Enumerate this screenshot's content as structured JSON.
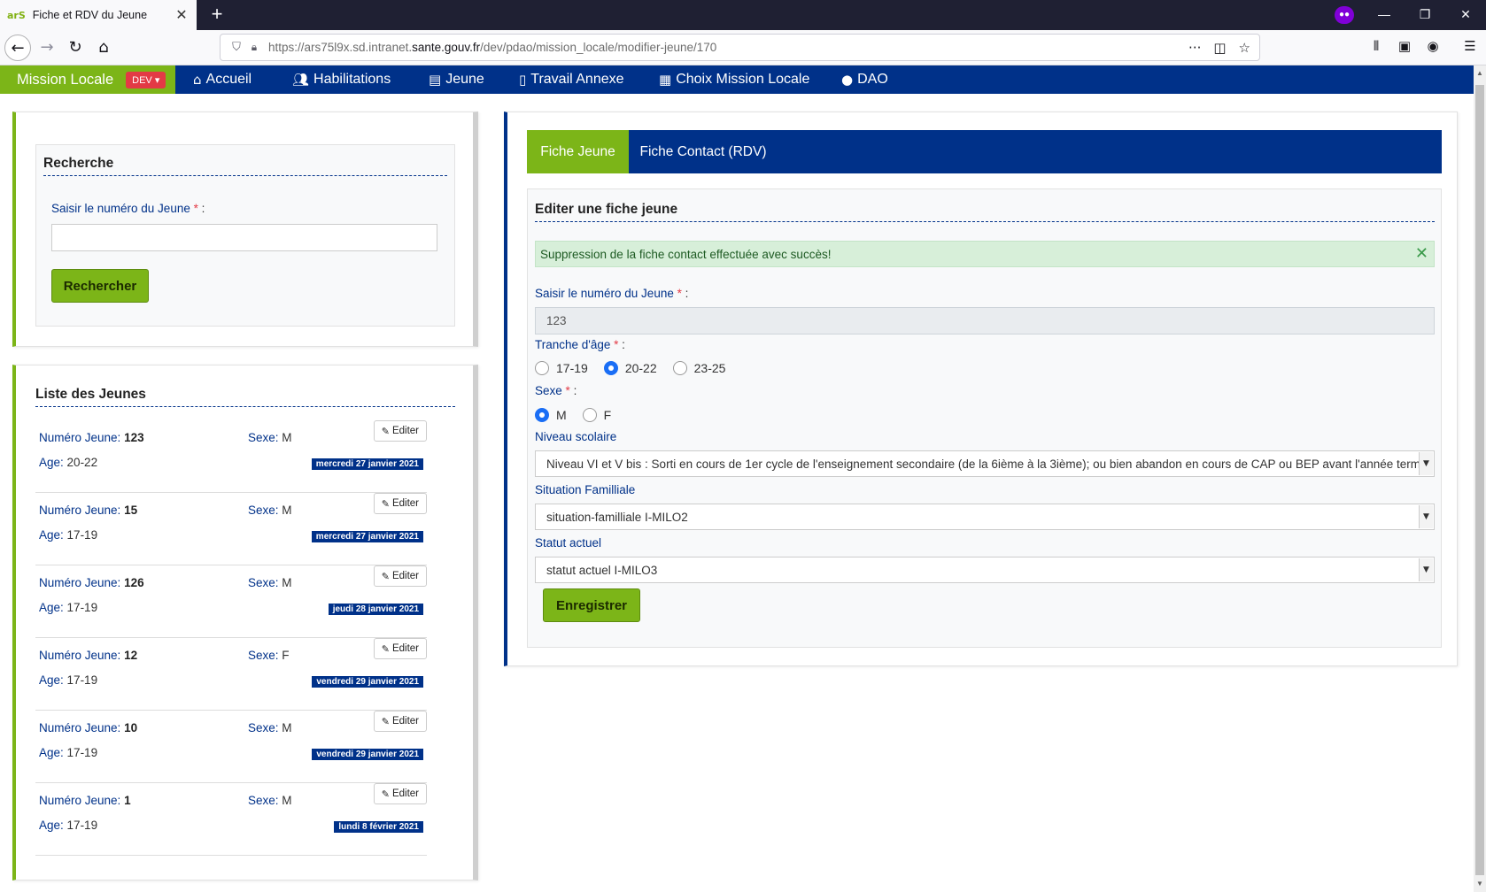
{
  "browser": {
    "tab_title": "Fiche et RDV du Jeune",
    "tab_favicon": "arS",
    "url_prefix": "https://ars75l9x.sd.intranet.",
    "url_host": "sante.gouv.fr",
    "url_path": "/dev/pdao/mission_locale/modifier-jeune/170",
    "icons": [
      "back-icon",
      "forward-icon",
      "reload-icon",
      "home-icon",
      "shield-icon",
      "lock-warning-icon",
      "more-icon",
      "pocket-icon",
      "star-icon",
      "library-icon",
      "sidebar-icon",
      "account-icon",
      "menu-icon",
      "private-browsing-icon"
    ]
  },
  "appnav": {
    "brand": "Mission Locale",
    "env_badge": "DEV ▾",
    "links": [
      {
        "label": "Accueil",
        "icon": "home-icon"
      },
      {
        "label": "Habilitations",
        "icon": "users-icon"
      },
      {
        "label": "Jeune",
        "icon": "id-card-icon"
      },
      {
        "label": "Travail Annexe",
        "icon": "file-icon"
      },
      {
        "label": "Choix Mission Locale",
        "icon": "building-icon"
      },
      {
        "label": "DAO",
        "icon": "user-circle-icon"
      }
    ],
    "colors": {
      "brand": "#7cb518",
      "navy": "#003189",
      "badge": "#e33a45"
    }
  },
  "recherche": {
    "title": "Recherche",
    "label": "Saisir le numéro du Jeune",
    "required": "*",
    "colon": " :",
    "value": "",
    "button": "Rechercher"
  },
  "liste": {
    "title": "Liste des Jeunes",
    "num_label": "Numéro Jeune:",
    "age_label": "Age:",
    "sexe_label": "Sexe:",
    "edit_label": "Editer",
    "items": [
      {
        "num": "123",
        "age": "20-22",
        "sexe": "M",
        "date": "mercredi 27 janvier 2021"
      },
      {
        "num": "15",
        "age": "17-19",
        "sexe": "M",
        "date": "mercredi 27 janvier 2021"
      },
      {
        "num": "126",
        "age": "17-19",
        "sexe": "M",
        "date": "jeudi 28 janvier 2021"
      },
      {
        "num": "12",
        "age": "17-19",
        "sexe": "F",
        "date": "vendredi 29 janvier 2021"
      },
      {
        "num": "10",
        "age": "17-19",
        "sexe": "M",
        "date": "vendredi 29 janvier 2021"
      },
      {
        "num": "1",
        "age": "17-19",
        "sexe": "M",
        "date": "lundi 8 février 2021"
      }
    ]
  },
  "fiche": {
    "tabs": [
      "Fiche Jeune",
      "Fiche Contact (RDV)"
    ],
    "active_tab": "Fiche Jeune",
    "title": "Editer une fiche jeune",
    "alert": "Suppression de la fiche contact effectuée avec succès!",
    "numero_label": "Saisir le numéro du Jeune",
    "numero_value": "123",
    "tranche_label": "Tranche d'âge",
    "tranche_options": [
      "17-19",
      "20-22",
      "23-25"
    ],
    "tranche_selected": "20-22",
    "sexe_label": "Sexe",
    "sexe_options": [
      "M",
      "F"
    ],
    "sexe_selected": "M",
    "niveau_label": "Niveau scolaire",
    "niveau_value": "Niveau VI et V bis : Sorti en cours de 1er cycle de l'enseignement secondaire (de la 6ième à la 3ième); ou bien abandon en cours de CAP ou BEP avant l'année terminale",
    "situation_label": "Situation Familliale",
    "situation_value": "situation-familliale I-MILO2",
    "statut_label": "Statut actuel",
    "statut_value": "statut actuel I-MILO3",
    "save_button": "Enregistrer"
  }
}
